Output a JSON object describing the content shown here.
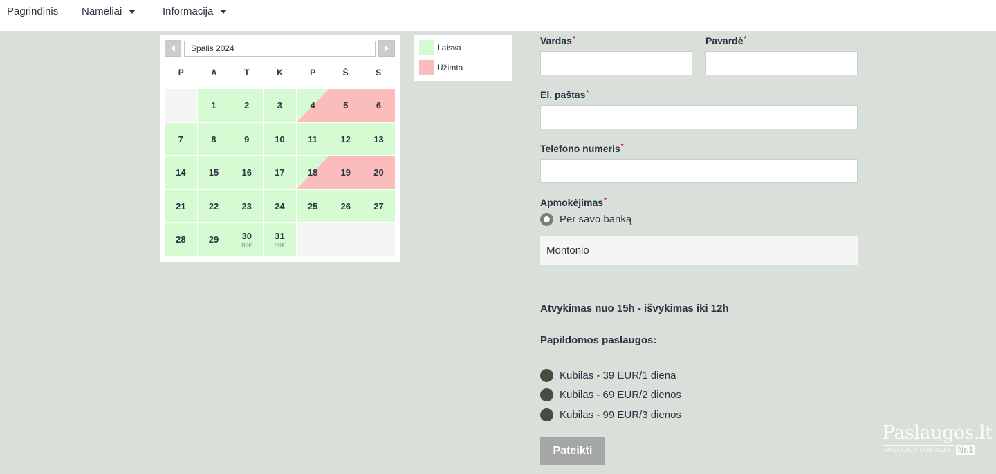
{
  "nav": {
    "items": [
      {
        "label": "Pagrindinis",
        "has_dropdown": false
      },
      {
        "label": "Nameliai",
        "has_dropdown": true
      },
      {
        "label": "Informacija",
        "has_dropdown": true
      }
    ]
  },
  "calendar": {
    "month_label": "Spalis 2024",
    "weekdays": [
      "P",
      "A",
      "T",
      "K",
      "P",
      "Š",
      "S"
    ],
    "days": [
      {
        "day": "",
        "status": "empty",
        "price": ""
      },
      {
        "day": "1",
        "status": "free",
        "price": ""
      },
      {
        "day": "2",
        "status": "free",
        "price": ""
      },
      {
        "day": "3",
        "status": "free",
        "price": ""
      },
      {
        "day": "4",
        "status": "half",
        "price": ""
      },
      {
        "day": "5",
        "status": "busy",
        "price": ""
      },
      {
        "day": "6",
        "status": "busy",
        "price": ""
      },
      {
        "day": "7",
        "status": "free",
        "price": ""
      },
      {
        "day": "8",
        "status": "free",
        "price": ""
      },
      {
        "day": "9",
        "status": "free",
        "price": ""
      },
      {
        "day": "10",
        "status": "free",
        "price": ""
      },
      {
        "day": "11",
        "status": "free",
        "price": ""
      },
      {
        "day": "12",
        "status": "free",
        "price": ""
      },
      {
        "day": "13",
        "status": "free",
        "price": ""
      },
      {
        "day": "14",
        "status": "free",
        "price": ""
      },
      {
        "day": "15",
        "status": "free",
        "price": ""
      },
      {
        "day": "16",
        "status": "free",
        "price": ""
      },
      {
        "day": "17",
        "status": "free",
        "price": ""
      },
      {
        "day": "18",
        "status": "half",
        "price": ""
      },
      {
        "day": "19",
        "status": "busy",
        "price": ""
      },
      {
        "day": "20",
        "status": "busy",
        "price": ""
      },
      {
        "day": "21",
        "status": "free",
        "price": ""
      },
      {
        "day": "22",
        "status": "free",
        "price": ""
      },
      {
        "day": "23",
        "status": "free",
        "price": ""
      },
      {
        "day": "24",
        "status": "free",
        "price": ""
      },
      {
        "day": "25",
        "status": "free",
        "price": ""
      },
      {
        "day": "26",
        "status": "free",
        "price": ""
      },
      {
        "day": "27",
        "status": "free",
        "price": ""
      },
      {
        "day": "28",
        "status": "free",
        "price": ""
      },
      {
        "day": "29",
        "status": "free",
        "price": ""
      },
      {
        "day": "30",
        "status": "free",
        "price": "89€"
      },
      {
        "day": "31",
        "status": "free",
        "price": "89€"
      },
      {
        "day": "",
        "status": "empty",
        "price": ""
      },
      {
        "day": "",
        "status": "empty",
        "price": ""
      },
      {
        "day": "",
        "status": "empty",
        "price": ""
      }
    ]
  },
  "legend": {
    "free_label": "Laisva",
    "busy_label": "Užimta",
    "free_color": "#d6fbd2",
    "busy_color": "#fbbcbc"
  },
  "form": {
    "first_name_label": "Vardas",
    "last_name_label": "Pavardė",
    "email_label": "El. paštas",
    "phone_label": "Telefono numeris",
    "payment_label": "Apmokėjimas",
    "required_mark": "*",
    "payment_option": "Per savo banką",
    "bank_select": "Montonio",
    "checkin_info": "Atvykimas nuo 15h - išvykimas iki 12h",
    "extras_label": "Papildomos paslaugos:",
    "extras": [
      "Kubilas - 39 EUR/1 diena",
      "Kubilas - 69 EUR/2 dienos",
      "Kubilas - 99 EUR/3 dienos"
    ],
    "submit_label": "Pateikti"
  },
  "watermark": {
    "logo": "Paslaugos.lt",
    "tagline": "PASLAUGŲ PORTALAS",
    "badge": "Nr.1"
  }
}
